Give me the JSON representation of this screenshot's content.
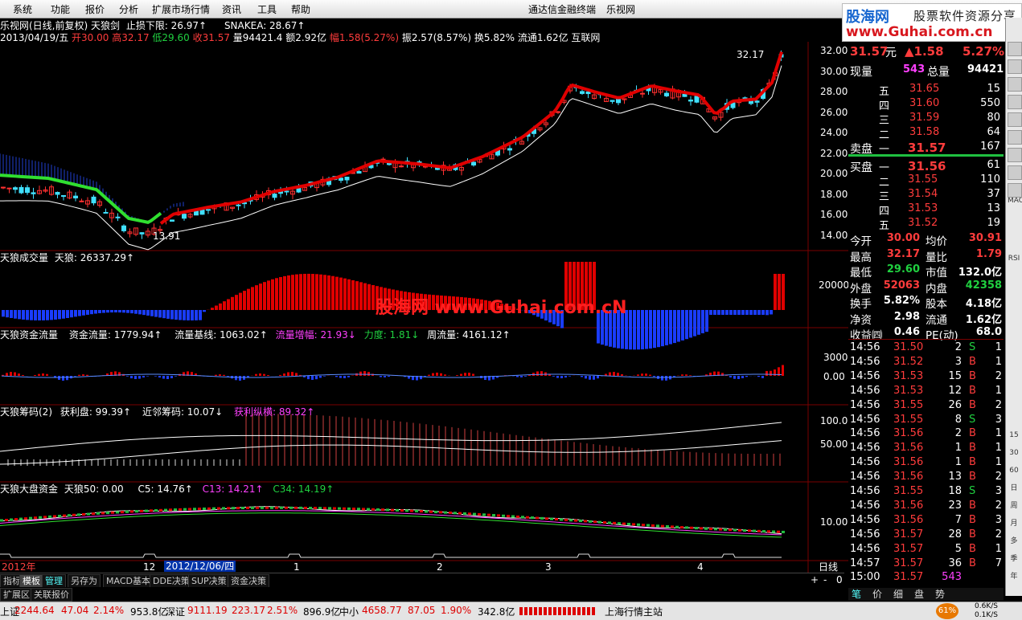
{
  "menu": {
    "items": [
      "系统",
      "功能",
      "报价",
      "分析",
      "扩展市场行情",
      "资讯",
      "工具",
      "帮助"
    ],
    "app_title": "通达信金融终端",
    "app_subtitle": "乐视网"
  },
  "watermark": {
    "brand": "股海网",
    "tagline": "股票软件资源分享",
    "url": "www.Guhai.com.cn",
    "center_text": "股海网 www.Guhai.com.cN"
  },
  "header": {
    "line1_prefix": "乐视网(日线,前复权) 天狼剑",
    "line1_stop": "止损下限: 26.97↑",
    "line1_snake": "SNAKEA: 28.67↑",
    "line2_date": "2013/04/19/五",
    "line2_open": "开30.00",
    "line2_high": "高32.17",
    "line2_low": "低29.60",
    "line2_close": "收31.57",
    "line2_vol": "量94421.4",
    "line2_amt": "额2.92亿",
    "line2_chg": "幅1.58(5.27%)",
    "line2_amp": "振2.57(8.57%)",
    "line2_turn": "换5.82%",
    "line2_float": "流通1.62亿",
    "line2_sector": "互联网"
  },
  "price_axis": [
    "32.00",
    "30.00",
    "28.00",
    "26.00",
    "24.00",
    "22.00",
    "20.00",
    "18.00",
    "16.00",
    "14.00"
  ],
  "price_labels": {
    "high": "32.17",
    "low": "13.91"
  },
  "panel2": {
    "title": "天狼成交量",
    "label": "天狼: 26337.29↑",
    "axis": "20000"
  },
  "panel3": {
    "title": "天狼资金流量",
    "flow": "资金流量: 1779.94↑",
    "base": "流量基线: 1063.02↑",
    "inc": "流量增幅: 21.93↓",
    "force": "力度: 1.81↓",
    "week": "周流量: 4161.12↑",
    "axis_top": "3000",
    "axis_mid": "0.00"
  },
  "panel4": {
    "title": "天狼筹码(2)",
    "profit": "获利盘: 99.39↑",
    "near": "近邻筹码: 10.07↓",
    "prof2": "获利纵横: 89.32↑",
    "axis_top": "100.0",
    "axis_mid": "50.00"
  },
  "panel5": {
    "title": "天狼大盘资金",
    "tl50": "天狼50: 0.00",
    "c5": "C5: 14.76↑",
    "c13": "C13: 14.21↑",
    "c34": "C34: 14.19↑",
    "axis": "10.00"
  },
  "date_axis": {
    "year": "2012年",
    "m12": "12",
    "sel": "2012/12/06/四",
    "m1": "1",
    "m2": "2",
    "m3": "3",
    "m4": "4",
    "period": "日线"
  },
  "bottom_tabs": [
    "指标",
    "模板",
    "管理",
    "另存为",
    "MACD基本",
    "DDE决策",
    "SUP决策",
    "资金决策"
  ],
  "bottom_row2": [
    "扩展区",
    "关联报价"
  ],
  "quote": {
    "price": "31.57",
    "unit": "元",
    "change": "▲1.58",
    "pct": "5.27%",
    "now_vol_label": "现量",
    "now_vol": "543",
    "total_label": "总量",
    "total": "94421",
    "asks": [
      [
        "五",
        "31.65",
        "15"
      ],
      [
        "四",
        "31.60",
        "550"
      ],
      [
        "三",
        "31.59",
        "80"
      ],
      [
        "二",
        "31.58",
        "64"
      ],
      [
        "一",
        "31.57",
        "167"
      ]
    ],
    "ask_label": "卖盘",
    "bids": [
      [
        "一",
        "31.56",
        "61"
      ],
      [
        "二",
        "31.55",
        "110"
      ],
      [
        "三",
        "31.54",
        "37"
      ],
      [
        "四",
        "31.53",
        "13"
      ],
      [
        "五",
        "31.52",
        "19"
      ]
    ],
    "bid_label": "买盘",
    "stats": [
      [
        "今开",
        "30.00",
        "均价",
        "30.91"
      ],
      [
        "最高",
        "32.17",
        "量比",
        "1.79"
      ],
      [
        "最低",
        "29.60",
        "市值",
        "132.0亿"
      ],
      [
        "外盘",
        "52063",
        "内盘",
        "42358"
      ],
      [
        "换手",
        "5.82%",
        "股本",
        "4.18亿"
      ],
      [
        "净资",
        "2.98",
        "流通",
        "1.62亿"
      ],
      [
        "收益㈣",
        "0.46",
        "PE(动)",
        "68.0"
      ]
    ],
    "ticks": [
      [
        "14:56",
        "31.50",
        "2",
        "S",
        "1"
      ],
      [
        "14:56",
        "31.52",
        "3",
        "B",
        "1"
      ],
      [
        "14:56",
        "31.53",
        "15",
        "B",
        "2"
      ],
      [
        "14:56",
        "31.53",
        "12",
        "B",
        "1"
      ],
      [
        "14:56",
        "31.55",
        "26",
        "B",
        "2"
      ],
      [
        "14:56",
        "31.55",
        "8",
        "S",
        "3"
      ],
      [
        "14:56",
        "31.56",
        "2",
        "B",
        "1"
      ],
      [
        "14:56",
        "31.56",
        "1",
        "B",
        "1"
      ],
      [
        "14:56",
        "31.56",
        "1",
        "B",
        "1"
      ],
      [
        "14:56",
        "31.56",
        "13",
        "B",
        "2"
      ],
      [
        "14:56",
        "31.55",
        "18",
        "S",
        "3"
      ],
      [
        "14:56",
        "31.56",
        "23",
        "B",
        "2"
      ],
      [
        "14:56",
        "31.56",
        "7",
        "B",
        "3"
      ],
      [
        "14:56",
        "31.57",
        "28",
        "B",
        "2"
      ],
      [
        "14:56",
        "31.57",
        "5",
        "B",
        "1"
      ],
      [
        "14:57",
        "31.57",
        "36",
        "B",
        "7"
      ],
      [
        "15:00",
        "31.57",
        "543",
        "",
        ""
      ]
    ],
    "tabs": [
      "笔",
      "价",
      "细",
      "盘",
      "势"
    ]
  },
  "toolstrip": [
    "MACD",
    "RSI",
    "15",
    "30",
    "60",
    "日",
    "周",
    "月",
    "多",
    "季",
    "年"
  ],
  "statusbar": {
    "sh_label": "上证",
    "sh": "2244.64",
    "sh_chg": "47.04",
    "sh_pct": "2.14%",
    "sh_amt": "953.8亿",
    "sz_label": "深证",
    "sz": "9111.19",
    "sz_chg": "223.17",
    "sz_pct": "2.51%",
    "sz_amt": "896.9亿",
    "zx_label": "中小",
    "zx": "4658.77",
    "zx_chg": "87.05",
    "zx_pct": "1.90%",
    "zx_amt": "342.8亿",
    "station": "上海行情主站",
    "cpu": "61%",
    "net_up": "0.6K/S",
    "net_down": "0.1K/S"
  },
  "colors": {
    "up": "#ff3c3c",
    "down": "#20d040",
    "ma_white": "#ffffff",
    "bg": "#000000",
    "grid": "#7a0000"
  }
}
